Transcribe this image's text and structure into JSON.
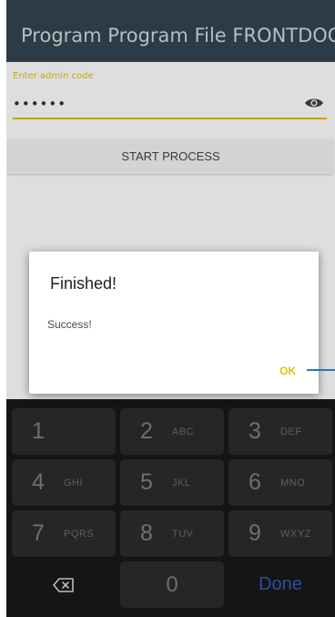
{
  "app_bar": {
    "title": "Program Program File FRONTDOO..."
  },
  "admin_field": {
    "label": "Enter admin code",
    "value": "••••••",
    "icon": "eye-icon"
  },
  "start_button": {
    "label": "START PROCESS"
  },
  "dialog": {
    "title": "Finished!",
    "message": "Success!",
    "ok_label": "OK"
  },
  "keyboard": {
    "keys": [
      {
        "num": "1",
        "letters": ""
      },
      {
        "num": "2",
        "letters": "ABC"
      },
      {
        "num": "3",
        "letters": "DEF"
      },
      {
        "num": "4",
        "letters": "GHI"
      },
      {
        "num": "5",
        "letters": "JKL"
      },
      {
        "num": "6",
        "letters": "MNO"
      },
      {
        "num": "7",
        "letters": "PQRS"
      },
      {
        "num": "8",
        "letters": "TUV"
      },
      {
        "num": "9",
        "letters": "WXYZ"
      },
      {
        "num": "0",
        "letters": ""
      }
    ],
    "done_label": "Done",
    "backspace_icon": "backspace-icon"
  },
  "colors": {
    "accent": "#c9a21a",
    "ok": "#e6c200",
    "done": "#2c4f9e",
    "app_bar": "#2c3b45"
  }
}
